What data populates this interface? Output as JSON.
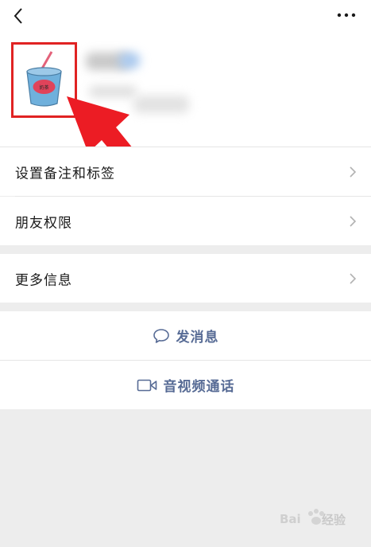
{
  "rows": {
    "remark_tags": "设置备注和标签",
    "friend_perms": "朋友权限",
    "more_info": "更多信息"
  },
  "actions": {
    "send_message": "发消息",
    "video_call": "音视频通话"
  },
  "avatar": {
    "cup_text": "奶茶"
  },
  "watermark": {
    "brand": "Bai",
    "product": "经验"
  },
  "colors": {
    "link_blue": "#576b95",
    "highlight_red": "#e02323",
    "separator_gray": "#ededed"
  }
}
